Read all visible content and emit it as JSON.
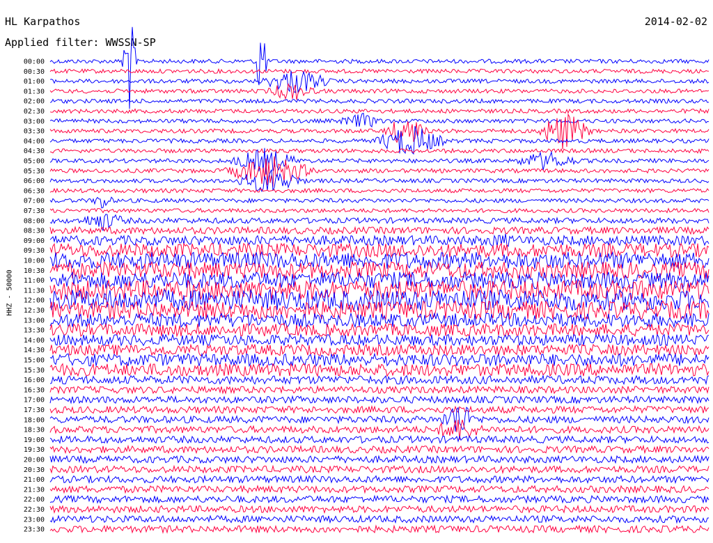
{
  "header": {
    "station": "HL Karpathos",
    "date": "2014-02-02",
    "filter": "Applied filter: WWSSN-SP"
  },
  "chart_data": {
    "type": "line",
    "title": "HL Karpathos",
    "subtitle": "Applied filter: WWSSN-SP",
    "ylabel": "HHZ - 50000",
    "xlabel": "",
    "row_labels": [
      "00:00",
      "00:30",
      "01:00",
      "01:30",
      "02:00",
      "02:30",
      "03:00",
      "03:30",
      "04:00",
      "04:30",
      "05:00",
      "05:30",
      "06:00",
      "06:30",
      "07:00",
      "07:30",
      "08:00",
      "08:30",
      "09:00",
      "09:30",
      "10:00",
      "10:30",
      "11:00",
      "11:30",
      "12:00",
      "12:30",
      "13:00",
      "13:30",
      "14:00",
      "14:30",
      "15:00",
      "15:30",
      "16:00",
      "16:30",
      "17:00",
      "17:30",
      "18:00",
      "18:30",
      "19:00",
      "19:30",
      "20:00",
      "20:30",
      "21:00",
      "21:30",
      "22:00",
      "22:30",
      "23:00",
      "23:30"
    ],
    "row_colors": [
      "#0000ff",
      "#ff0040"
    ],
    "row_noise_amplitude": [
      3,
      3,
      3,
      3,
      3,
      3,
      3,
      3,
      3,
      3,
      3,
      3,
      3,
      3,
      3,
      3,
      4,
      5,
      7,
      10,
      12,
      12,
      12,
      14,
      15,
      13,
      10,
      9,
      8,
      8,
      9,
      9,
      6,
      5,
      5,
      5,
      5,
      5,
      5,
      5,
      5,
      5,
      5,
      5,
      5,
      5,
      5,
      5
    ],
    "events": [
      {
        "row_index": 0,
        "minute": 3.6,
        "amplitude": 80,
        "duration_minutes": 0.4
      },
      {
        "row_index": 0,
        "minute": 9.6,
        "amplitude": 80,
        "duration_minutes": 0.3
      },
      {
        "row_index": 2,
        "minute": 11.2,
        "amplitude": 20,
        "duration_minutes": 2.0
      },
      {
        "row_index": 3,
        "minute": 11.0,
        "amplitude": 15,
        "duration_minutes": 1.5
      },
      {
        "row_index": 6,
        "minute": 14.2,
        "amplitude": 12,
        "duration_minutes": 1.5
      },
      {
        "row_index": 7,
        "minute": 16.2,
        "amplitude": 25,
        "duration_minutes": 1.2
      },
      {
        "row_index": 7,
        "minute": 23.4,
        "amplitude": 30,
        "duration_minutes": 1.5
      },
      {
        "row_index": 8,
        "minute": 16.4,
        "amplitude": 25,
        "duration_minutes": 2.0
      },
      {
        "row_index": 10,
        "minute": 9.8,
        "amplitude": 20,
        "duration_minutes": 2.0
      },
      {
        "row_index": 10,
        "minute": 22.6,
        "amplitude": 15,
        "duration_minutes": 2.0
      },
      {
        "row_index": 11,
        "minute": 10.0,
        "amplitude": 25,
        "duration_minutes": 2.5
      },
      {
        "row_index": 12,
        "minute": 10.0,
        "amplitude": 20,
        "duration_minutes": 2.0
      },
      {
        "row_index": 14,
        "minute": 2.4,
        "amplitude": 15,
        "duration_minutes": 0.6
      },
      {
        "row_index": 16,
        "minute": 2.4,
        "amplitude": 15,
        "duration_minutes": 1.5
      },
      {
        "row_index": 18,
        "minute": 20.5,
        "amplitude": 12,
        "duration_minutes": 1.5
      },
      {
        "row_index": 36,
        "minute": 18.6,
        "amplitude": 30,
        "duration_minutes": 1.0
      },
      {
        "row_index": 37,
        "minute": 18.6,
        "amplitude": 20,
        "duration_minutes": 1.5
      }
    ]
  }
}
